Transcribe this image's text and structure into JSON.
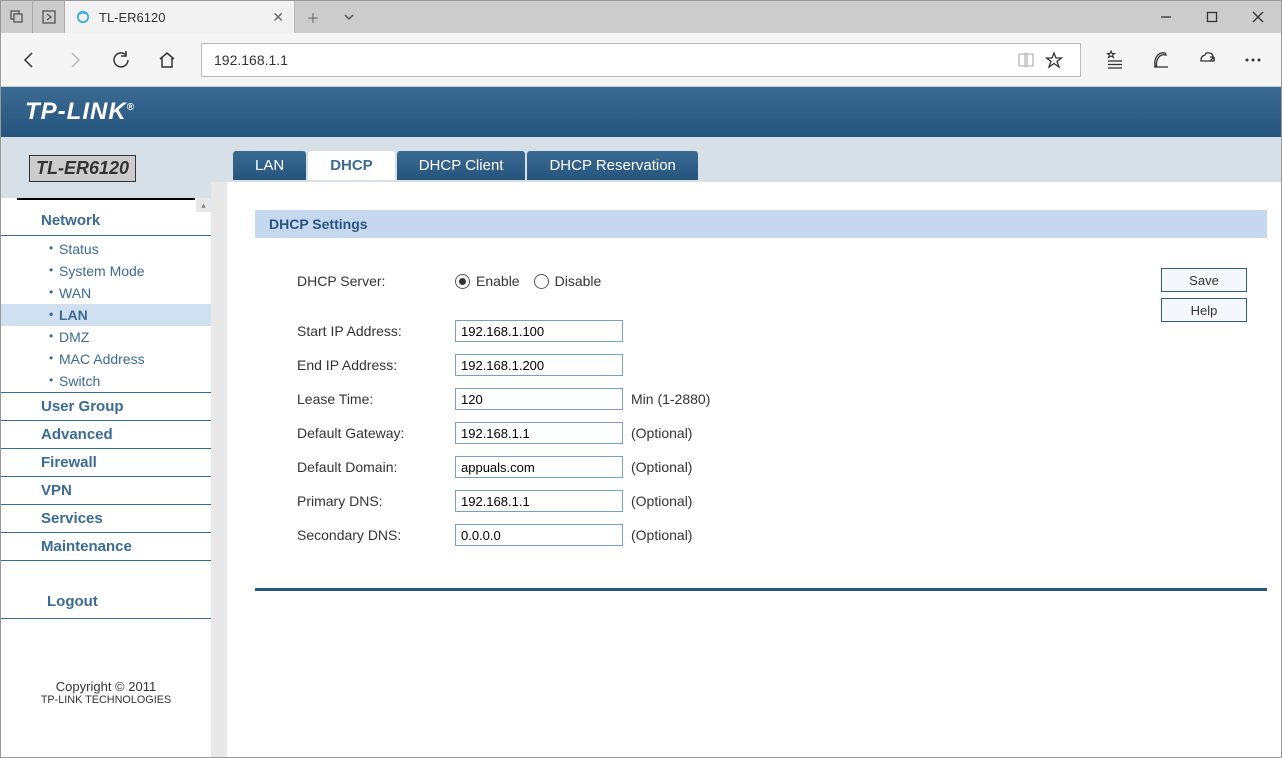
{
  "browser": {
    "tab_title": "TL-ER6120",
    "address": "192.168.1.1"
  },
  "brand": "TP-LINK",
  "model": "TL-ER6120",
  "sidebar": {
    "heading": "Network",
    "items": [
      {
        "label": "Status"
      },
      {
        "label": "System Mode"
      },
      {
        "label": "WAN"
      },
      {
        "label": "LAN",
        "active": true
      },
      {
        "label": "DMZ"
      },
      {
        "label": "MAC Address"
      },
      {
        "label": "Switch"
      }
    ],
    "sections": [
      "User Group",
      "Advanced",
      "Firewall",
      "VPN",
      "Services",
      "Maintenance"
    ],
    "logout": "Logout",
    "copyright_line1": "Copyright © 2011",
    "copyright_line2": "TP-LINK TECHNOLOGIES"
  },
  "tabs": [
    {
      "label": "LAN"
    },
    {
      "label": "DHCP",
      "active": true
    },
    {
      "label": "DHCP Client"
    },
    {
      "label": "DHCP Reservation"
    }
  ],
  "section_title": "DHCP Settings",
  "form": {
    "dhcp_server_label": "DHCP Server:",
    "enable_label": "Enable",
    "disable_label": "Disable",
    "dhcp_server_value": "enable",
    "start_ip_label": "Start IP Address:",
    "start_ip_value": "192.168.1.100",
    "end_ip_label": "End IP Address:",
    "end_ip_value": "192.168.1.200",
    "lease_label": "Lease Time:",
    "lease_value": "120",
    "lease_hint": "Min (1-2880)",
    "gateway_label": "Default Gateway:",
    "gateway_value": "192.168.1.1",
    "domain_label": "Default Domain:",
    "domain_value": "appuals.com",
    "pdns_label": "Primary DNS:",
    "pdns_value": "192.168.1.1",
    "sdns_label": "Secondary DNS:",
    "sdns_value": "0.0.0.0",
    "optional": "(Optional)"
  },
  "buttons": {
    "save": "Save",
    "help": "Help"
  }
}
